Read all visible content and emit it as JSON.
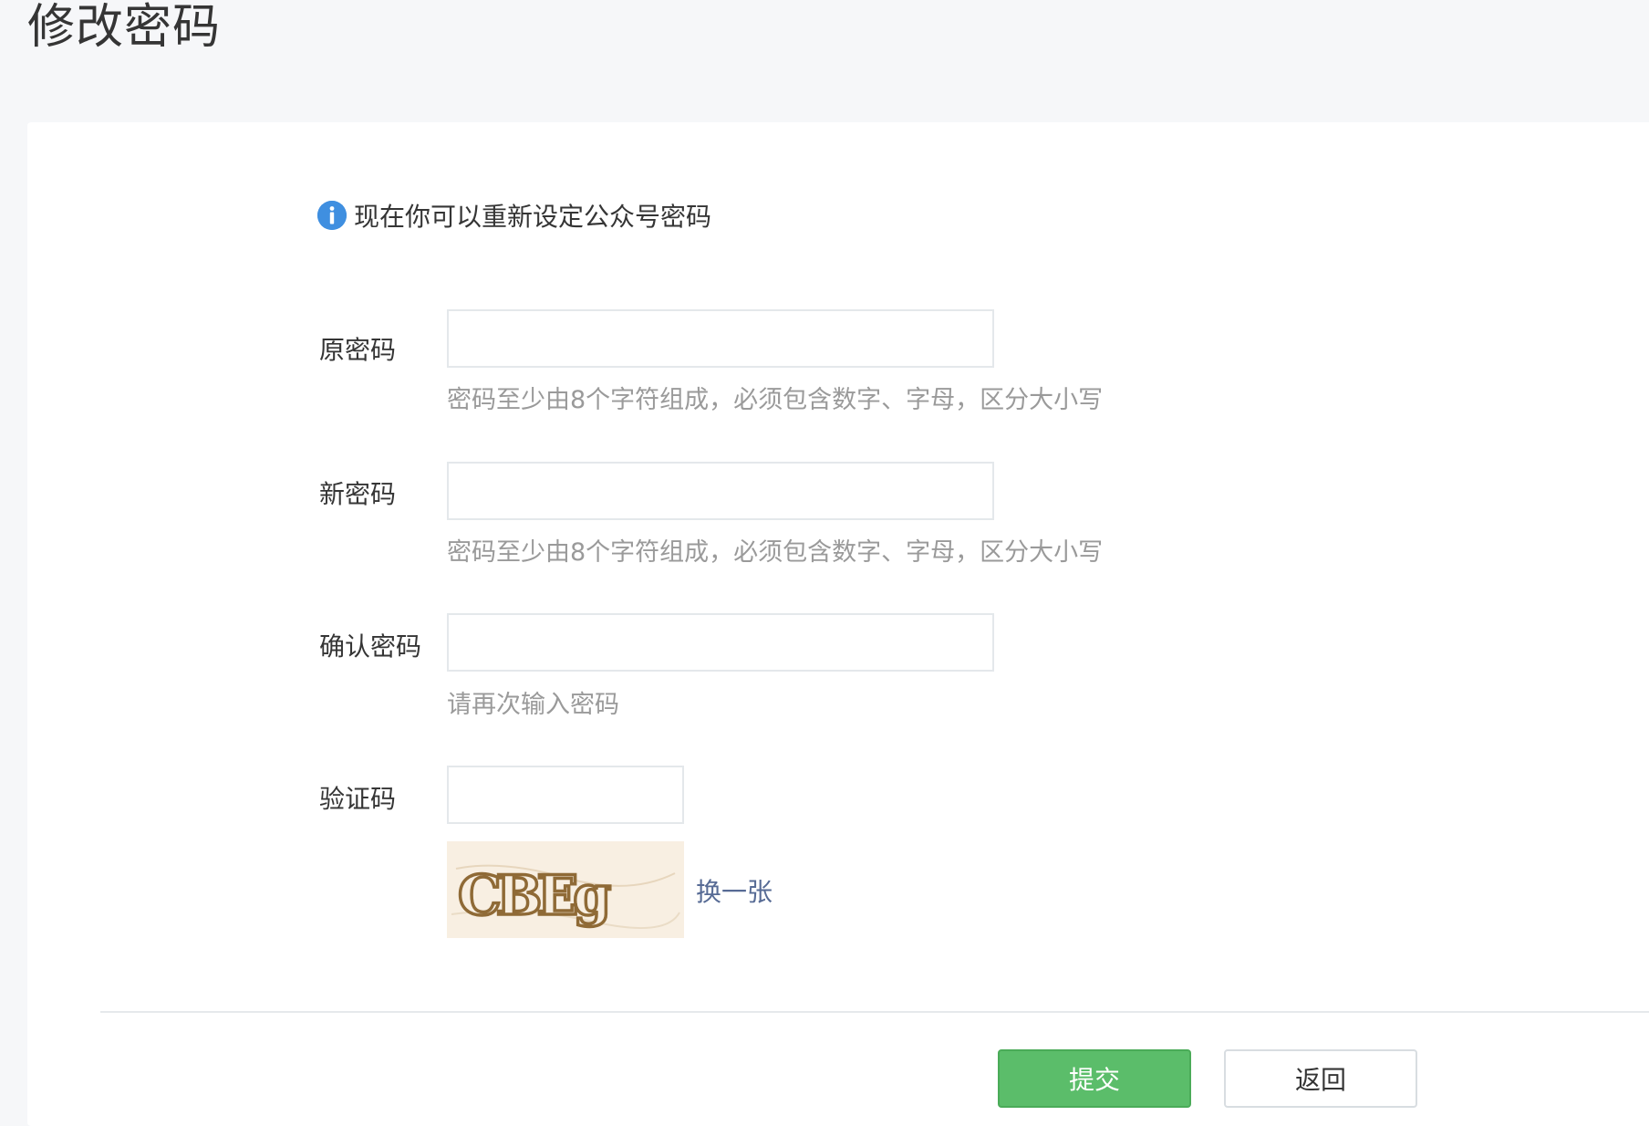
{
  "page": {
    "title": "修改密码"
  },
  "notice": {
    "icon": "info-icon",
    "text": "现在你可以重新设定公众号密码"
  },
  "form": {
    "old_password": {
      "label": "原密码",
      "value": "",
      "hint": "密码至少由8个字符组成，必须包含数字、字母，区分大小写"
    },
    "new_password": {
      "label": "新密码",
      "value": "",
      "hint": "密码至少由8个字符组成，必须包含数字、字母，区分大小写"
    },
    "confirm_password": {
      "label": "确认密码",
      "value": "",
      "hint": "请再次输入密码"
    },
    "captcha": {
      "label": "验证码",
      "value": "",
      "image_text": "CBEg",
      "refresh_label": "换一张"
    }
  },
  "actions": {
    "submit_label": "提交",
    "back_label": "返回"
  },
  "colors": {
    "primary": "#5bbd6a",
    "link": "#576b95",
    "info": "#3f8fe0",
    "hint": "#9a9a9a"
  }
}
